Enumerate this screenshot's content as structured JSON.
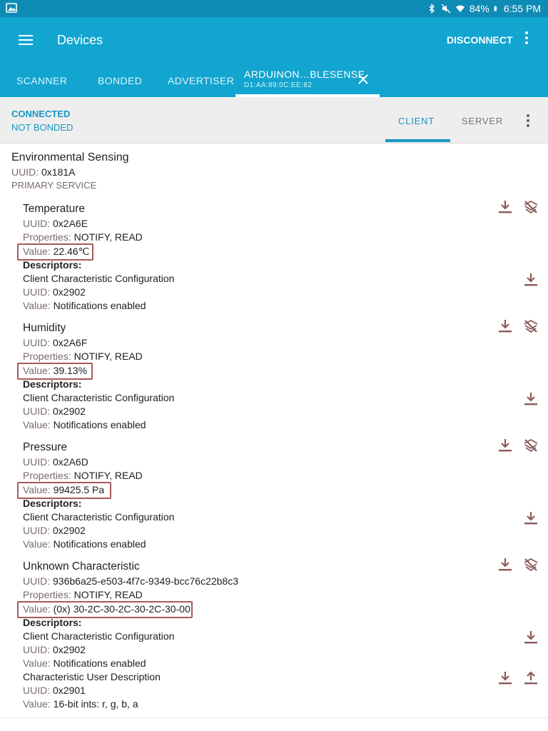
{
  "status_bar": {
    "battery": "84%",
    "time": "6:55 PM"
  },
  "app_bar": {
    "title": "Devices",
    "disconnect_label": "DISCONNECT"
  },
  "tabs": [
    {
      "label": "SCANNER"
    },
    {
      "label": "BONDED"
    },
    {
      "label": "ADVERTISER"
    },
    {
      "label": "ARDUINON…BLESENSE",
      "sublabel": "D1:AA:89:0C:EE:82",
      "active": true
    }
  ],
  "connection": {
    "state": "CONNECTED",
    "bond": "NOT BONDED",
    "client_tab": "CLIENT",
    "server_tab": "SERVER"
  },
  "service": {
    "name": "Environmental Sensing",
    "uuid_label": "UUID:",
    "uuid": "0x181A",
    "type": "PRIMARY SERVICE"
  },
  "labels": {
    "uuid": "UUID:",
    "properties": "Properties:",
    "value": "Value:",
    "descriptors": "Descriptors:"
  },
  "characteristics": [
    {
      "name": "Temperature",
      "uuid": "0x2A6E",
      "properties": "NOTIFY, READ",
      "value": "22.46℃",
      "descriptors": [
        {
          "name": "Client Characteristic Configuration",
          "uuid": "0x2902",
          "value": "Notifications enabled"
        }
      ]
    },
    {
      "name": "Humidity",
      "uuid": "0x2A6F",
      "properties": "NOTIFY, READ",
      "value": "39.13%",
      "descriptors": [
        {
          "name": "Client Characteristic Configuration",
          "uuid": "0x2902",
          "value": "Notifications enabled"
        }
      ]
    },
    {
      "name": "Pressure",
      "uuid": "0x2A6D",
      "properties": "NOTIFY, READ",
      "value": "99425.5 Pa",
      "descriptors": [
        {
          "name": "Client Characteristic Configuration",
          "uuid": "0x2902",
          "value": "Notifications enabled"
        }
      ]
    },
    {
      "name": "Unknown Characteristic",
      "uuid": "936b6a25-e503-4f7c-9349-bcc76c22b8c3",
      "properties": "NOTIFY, READ",
      "value": "(0x) 30-2C-30-2C-30-2C-30-00",
      "descriptors": [
        {
          "name": "Client Characteristic Configuration",
          "uuid": "0x2902",
          "value": "Notifications enabled"
        },
        {
          "name": "Characteristic User Description",
          "uuid": "0x2901",
          "value": "16-bit ints: r, g, b, a"
        }
      ]
    }
  ],
  "colors": {
    "status_bar": "#0e8bb5",
    "app_bar": "#11a5d0",
    "accent": "#1797c2",
    "action_icon": "#8a5a5a",
    "highlight_box": "#a65a5a"
  },
  "icons": {
    "read": "download-icon",
    "notify": "notify-off-icon",
    "write": "upload-icon"
  }
}
